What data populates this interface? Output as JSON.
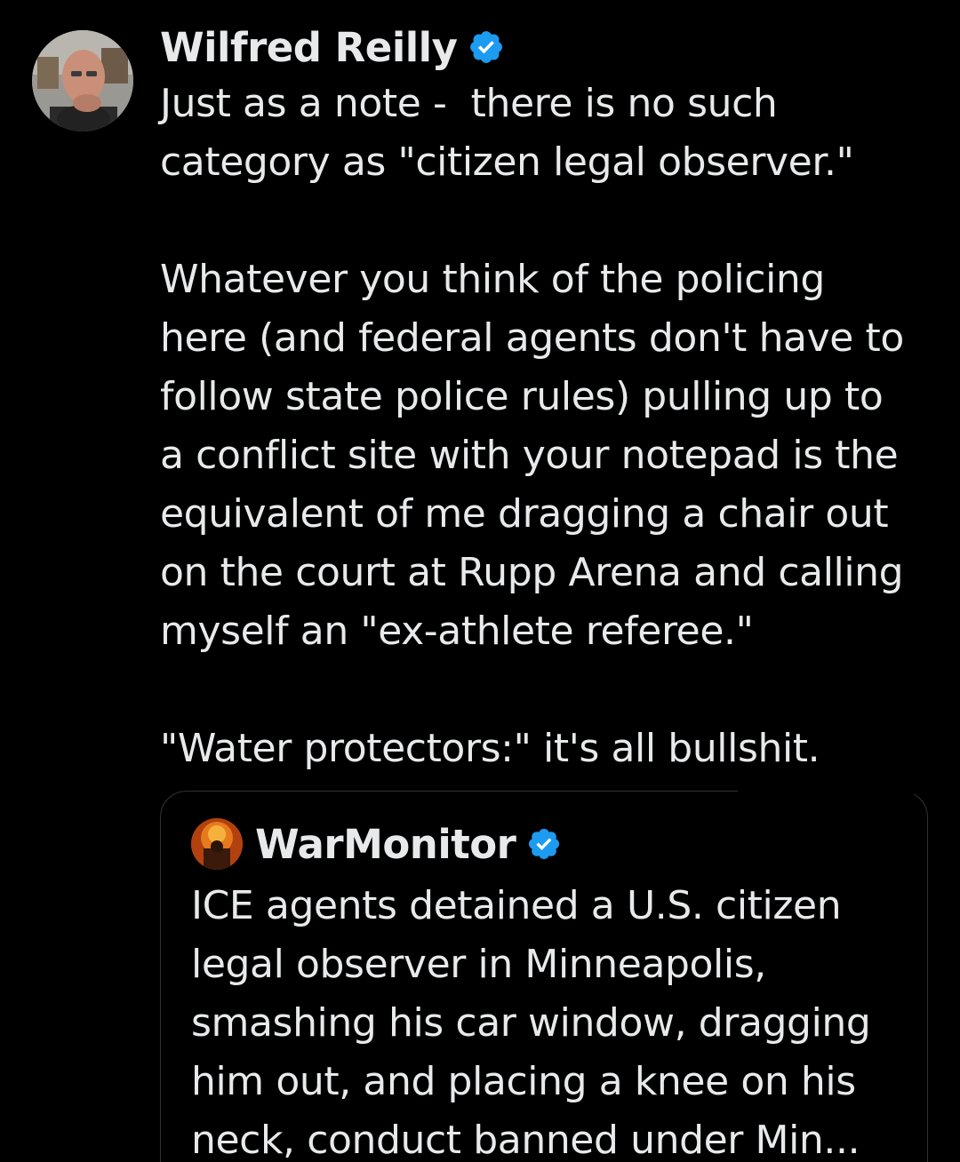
{
  "tweet": {
    "display_name": "Wilfred Reilly",
    "verified": true,
    "body_lines": [
      "Just as a note -  there is no such",
      "category as \"citizen legal observer.\"",
      "",
      "Whatever you think of the policing",
      "here (and federal agents don't have to",
      "follow state police rules) pulling up to",
      "a conflict site with your notepad is the",
      "equivalent of me dragging a chair out",
      "on the court at Rupp Arena and calling",
      "myself an \"ex-athlete referee.\"",
      "",
      "\"Water protectors:\" it's all bullshit."
    ]
  },
  "quoted_tweet": {
    "display_name": "WarMonitor",
    "verified": true,
    "body_lines": [
      "ICE agents detained a U.S. citizen",
      "legal observer in Minneapolis,",
      "smashing his car window, dragging",
      "him out, and placing a knee on his",
      "neck, conduct banned under Min..."
    ]
  },
  "colors": {
    "background": "#000000",
    "text": "#e7e9ea",
    "verified_badge": "#1d9bf0",
    "card_border": "#2f3336"
  }
}
